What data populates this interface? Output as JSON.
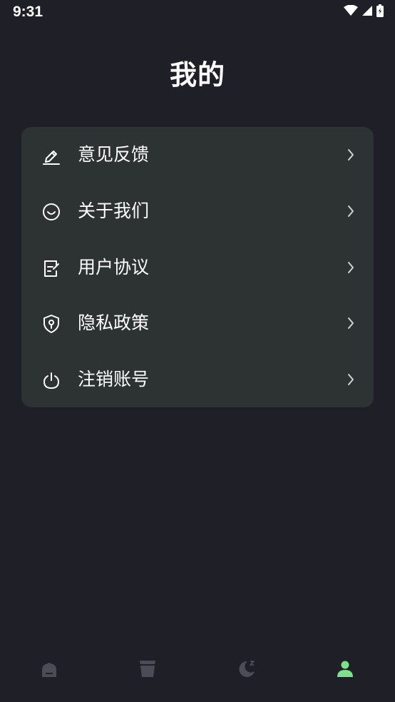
{
  "status_bar": {
    "time": "9:31",
    "icons": [
      "wifi-icon",
      "signal-icon",
      "battery-icon"
    ]
  },
  "header": {
    "title": "我的"
  },
  "menu": {
    "items": [
      {
        "label": "意见反馈",
        "icon": "edit-pencil-icon"
      },
      {
        "label": "关于我们",
        "icon": "smile-icon"
      },
      {
        "label": "用户协议",
        "icon": "document-edit-icon"
      },
      {
        "label": "隐私政策",
        "icon": "shield-icon"
      },
      {
        "label": "注销账号",
        "icon": "power-icon"
      }
    ]
  },
  "tabbar": {
    "tabs": [
      {
        "icon": "home-icon",
        "active": false
      },
      {
        "icon": "cup-icon",
        "active": false
      },
      {
        "icon": "sleep-moon-icon",
        "active": false
      },
      {
        "icon": "profile-icon",
        "active": true
      }
    ]
  },
  "colors": {
    "background": "#1f1f27",
    "card": "#2c3332",
    "active_tab": "#7ee08a",
    "inactive_tab": "#4a4d55"
  }
}
